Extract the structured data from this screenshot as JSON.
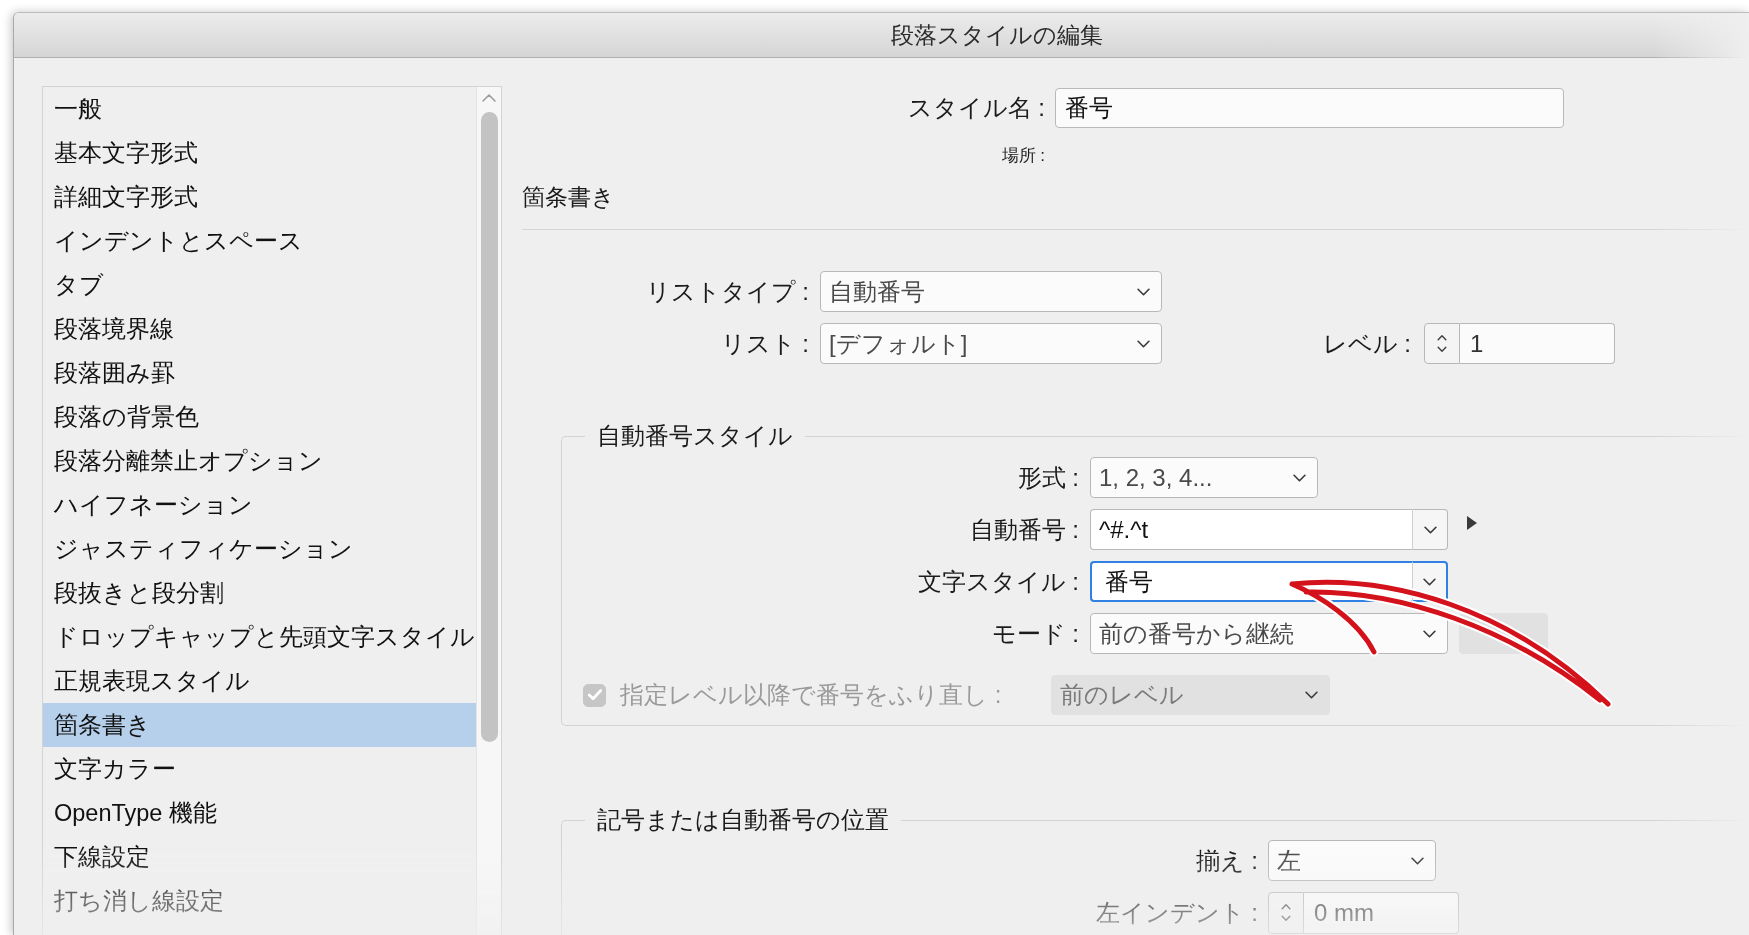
{
  "window": {
    "title": "段落スタイルの編集"
  },
  "sidebar": {
    "items": [
      {
        "label": "一般",
        "selected": false
      },
      {
        "label": "基本文字形式",
        "selected": false
      },
      {
        "label": "詳細文字形式",
        "selected": false
      },
      {
        "label": "インデントとスペース",
        "selected": false
      },
      {
        "label": "タブ",
        "selected": false
      },
      {
        "label": "段落境界線",
        "selected": false
      },
      {
        "label": "段落囲み罫",
        "selected": false
      },
      {
        "label": "段落の背景色",
        "selected": false
      },
      {
        "label": "段落分離禁止オプション",
        "selected": false
      },
      {
        "label": "ハイフネーション",
        "selected": false
      },
      {
        "label": "ジャスティフィケーション",
        "selected": false
      },
      {
        "label": "段抜きと段分割",
        "selected": false
      },
      {
        "label": "ドロップキャップと先頭文字スタイル",
        "selected": false
      },
      {
        "label": "正規表現スタイル",
        "selected": false
      },
      {
        "label": "箇条書き",
        "selected": true
      },
      {
        "label": "文字カラー",
        "selected": false
      },
      {
        "label": "OpenType 機能",
        "selected": false
      },
      {
        "label": "下線設定",
        "selected": false
      },
      {
        "label": "打ち消し線設定",
        "selected": false
      }
    ]
  },
  "style_name": {
    "label": "スタイル名 :",
    "value": "番号"
  },
  "location": {
    "label": "場所 :"
  },
  "section": {
    "title": "箇条書き",
    "list_type": {
      "label": "リストタイプ :",
      "value": "自動番号"
    },
    "list": {
      "label": "リスト :",
      "value": "[デフォルト]"
    },
    "level": {
      "label": "レベル :",
      "value": "1"
    }
  },
  "groups": [
    {
      "title": "自動番号スタイル",
      "rows": [
        {
          "kind": "dropdown",
          "label": "形式 :",
          "value": "1, 2, 3, 4..."
        },
        {
          "kind": "combo",
          "label": "自動番号 :",
          "value": "^#.^t",
          "focused": false,
          "accessory": {
            "kind": "menu"
          }
        },
        {
          "kind": "combo",
          "label": "文字スタイル :",
          "value": "番号",
          "focused": true
        },
        {
          "kind": "dropdown",
          "label": "モード :",
          "value": "前の番号から継続",
          "accessory": {
            "kind": "button",
            "disabled": true
          }
        },
        {
          "kind": "checkbox",
          "label": "指定レベル以降で番号をふり直し :",
          "checked": true,
          "disabled": true,
          "value": "前のレベル"
        }
      ]
    },
    {
      "title": "記号または自動番号の位置",
      "rows": [
        {
          "kind": "dropdown",
          "label": "揃え :",
          "value": "左"
        },
        {
          "kind": "stepper",
          "label": "左インデント :",
          "value": "0 mm"
        }
      ]
    }
  ]
}
